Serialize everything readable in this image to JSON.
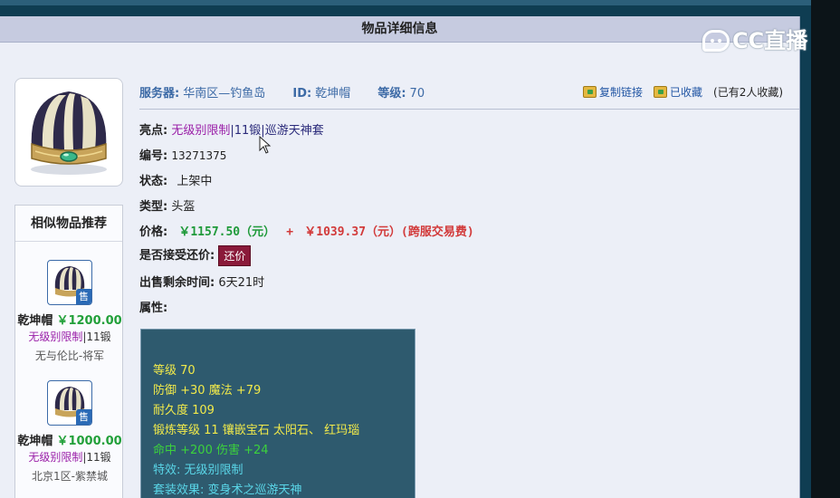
{
  "header": {
    "title": "物品详细信息"
  },
  "watermark": {
    "text": "CC直播"
  },
  "meta": {
    "server_label": "服务器:",
    "server_value": "华南区—钓鱼岛",
    "id_label": "ID:",
    "id_value": "乾坤帽",
    "level_label": "等级:",
    "level_value": "70"
  },
  "actions": {
    "copy_link": "复制链接",
    "favorited": "已收藏",
    "fav_count": "(已有2人收藏)"
  },
  "details": {
    "highlight_label": "亮点:",
    "highlight_tag1": "无级别限制",
    "highlight_sep1": "|",
    "highlight_tag2": "11锻",
    "highlight_sep2": "|",
    "highlight_tag3": "巡游天神套",
    "number_label": "编号:",
    "number_value": "13271375",
    "status_label": "状态:",
    "status_value": "上架中",
    "type_label": "类型:",
    "type_value": "头盔",
    "price_label": "价格:",
    "price_main": "￥1157.50（元）",
    "price_plus": "+",
    "price_fee": "￥1039.37（元）(跨服交易费)",
    "bargain_label": "是否接受还价:",
    "bargain_button": "还价",
    "remaining_label": "出售剩余时间:",
    "remaining_value": "6天21时",
    "attr_label": "属性:"
  },
  "attributes": {
    "line1": "等级 70",
    "line2": "防御 +30 魔法 +79",
    "line3": "耐久度 109",
    "line4": "锻炼等级 11 镶嵌宝石 太阳石、 红玛瑙",
    "line5": "命中 +200 伤害 +24",
    "line6": "特效: 无级别限制",
    "line7": "套装效果: 变身术之巡游天神"
  },
  "similar": {
    "title": "相似物品推荐",
    "items": [
      {
        "name": "乾坤帽",
        "price": "￥1200.00",
        "tag1": "无级别限制",
        "sep": "|",
        "tag2": "11锻",
        "server": "无与伦比-将军",
        "badge": "售"
      },
      {
        "name": "乾坤帽",
        "price": "￥1000.00",
        "tag1": "无级别限制",
        "sep": "|",
        "tag2": "11锻",
        "server": "北京1区-紫禁城",
        "badge": "售"
      }
    ]
  },
  "colors": {
    "header_bg": "#c6cbe0",
    "panel_bg": "#eceff7",
    "attr_bg": "#2e5a6e",
    "accent_blue": "#3c6aa6",
    "price_green": "#1f9a3a",
    "price_red": "#d23a3a",
    "tag_purple": "#9a1fa8",
    "bargain_bg": "#8a1a3a"
  }
}
